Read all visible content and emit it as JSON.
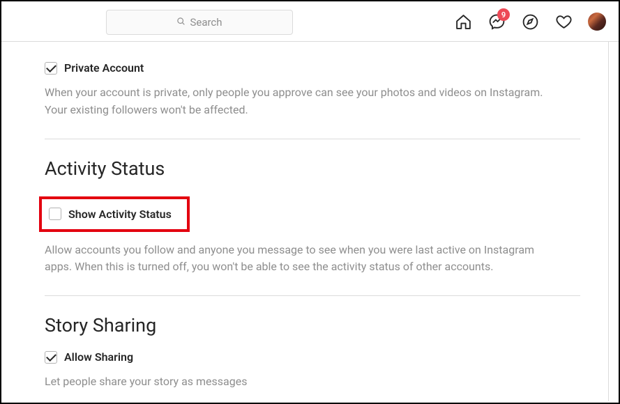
{
  "header": {
    "search_placeholder": "Search",
    "messenger_badge": "9"
  },
  "sections": {
    "private": {
      "checkbox_label": "Private Account",
      "description": "When your account is private, only people you approve can see your photos and videos on Instagram. Your existing followers won't be affected."
    },
    "activity": {
      "heading": "Activity Status",
      "checkbox_label": "Show Activity Status",
      "description": "Allow accounts you follow and anyone you message to see when you were last active on Instagram apps. When this is turned off, you won't be able to see the activity status of other accounts."
    },
    "story": {
      "heading": "Story Sharing",
      "checkbox_label": "Allow Sharing",
      "description": "Let people share your story as messages"
    }
  }
}
